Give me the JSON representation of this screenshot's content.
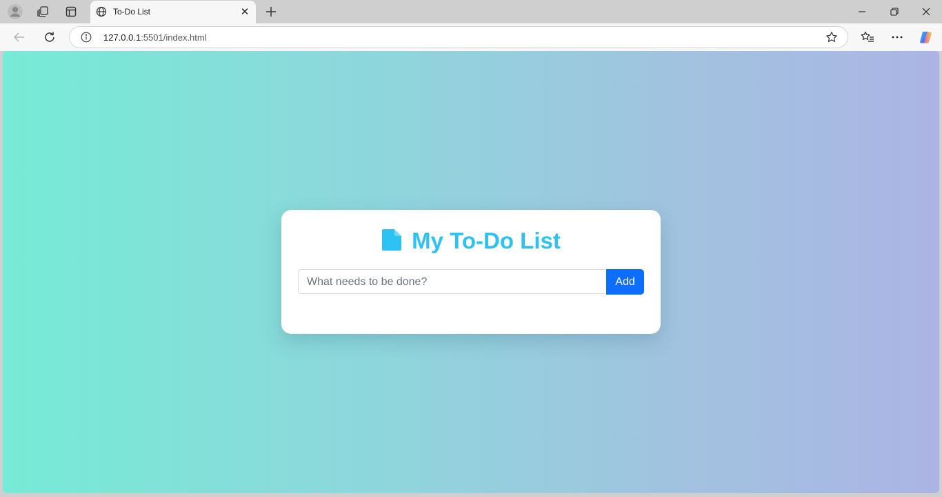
{
  "browser": {
    "tab": {
      "title": "To-Do List"
    },
    "address": {
      "host": "127.0.0.1",
      "path": ":5501/index.html"
    }
  },
  "page": {
    "heading": "My To-Do List",
    "input": {
      "placeholder": "What needs to be done?"
    },
    "add_button": "Add"
  },
  "colors": {
    "gradient_start": "#76ebd6",
    "gradient_end": "#abb4e4",
    "heading": "#2dc2f2",
    "button": "#0d6efd"
  },
  "icons": {
    "profile": "profile-icon",
    "workspaces": "workspaces-icon",
    "tab_actions": "tab-actions-icon",
    "favicon": "globe-icon",
    "close_tab": "close-icon",
    "new_tab": "plus-icon",
    "minimize": "minimize-icon",
    "restore": "restore-icon",
    "close_window": "close-icon",
    "back": "back-arrow-icon",
    "refresh": "refresh-icon",
    "site_info": "info-icon",
    "favorite": "star-icon",
    "favorites_list": "favorites-icon",
    "more": "more-icon",
    "copilot": "copilot-icon",
    "heading_icon": "note-icon"
  }
}
